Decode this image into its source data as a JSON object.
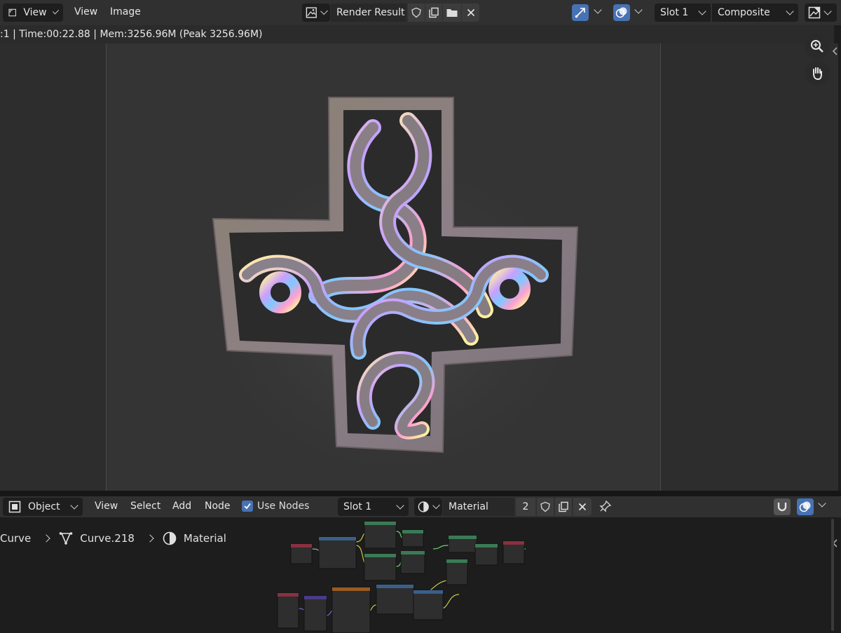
{
  "image_editor": {
    "editor_type_label": "View",
    "menus": [
      "View",
      "Image"
    ],
    "image_name": "Render Result",
    "slot": "Slot 1",
    "layer": "Composite",
    "status_text": ":1 | Time:00:22.88 | Mem:3256.96M (Peak 3256.96M)"
  },
  "node_editor": {
    "mode": "Object",
    "menus": [
      "View",
      "Select",
      "Add",
      "Node"
    ],
    "use_nodes_label": "Use Nodes",
    "slot": "Slot 1",
    "material_name": "Material",
    "user_count": "2",
    "breadcrumb": [
      "Curve",
      "Curve.218",
      "Material"
    ]
  },
  "colors": {
    "header": "#303030",
    "accent": "#4772b3",
    "viewport": "#2d2d2d",
    "render_bg": "#343434"
  }
}
